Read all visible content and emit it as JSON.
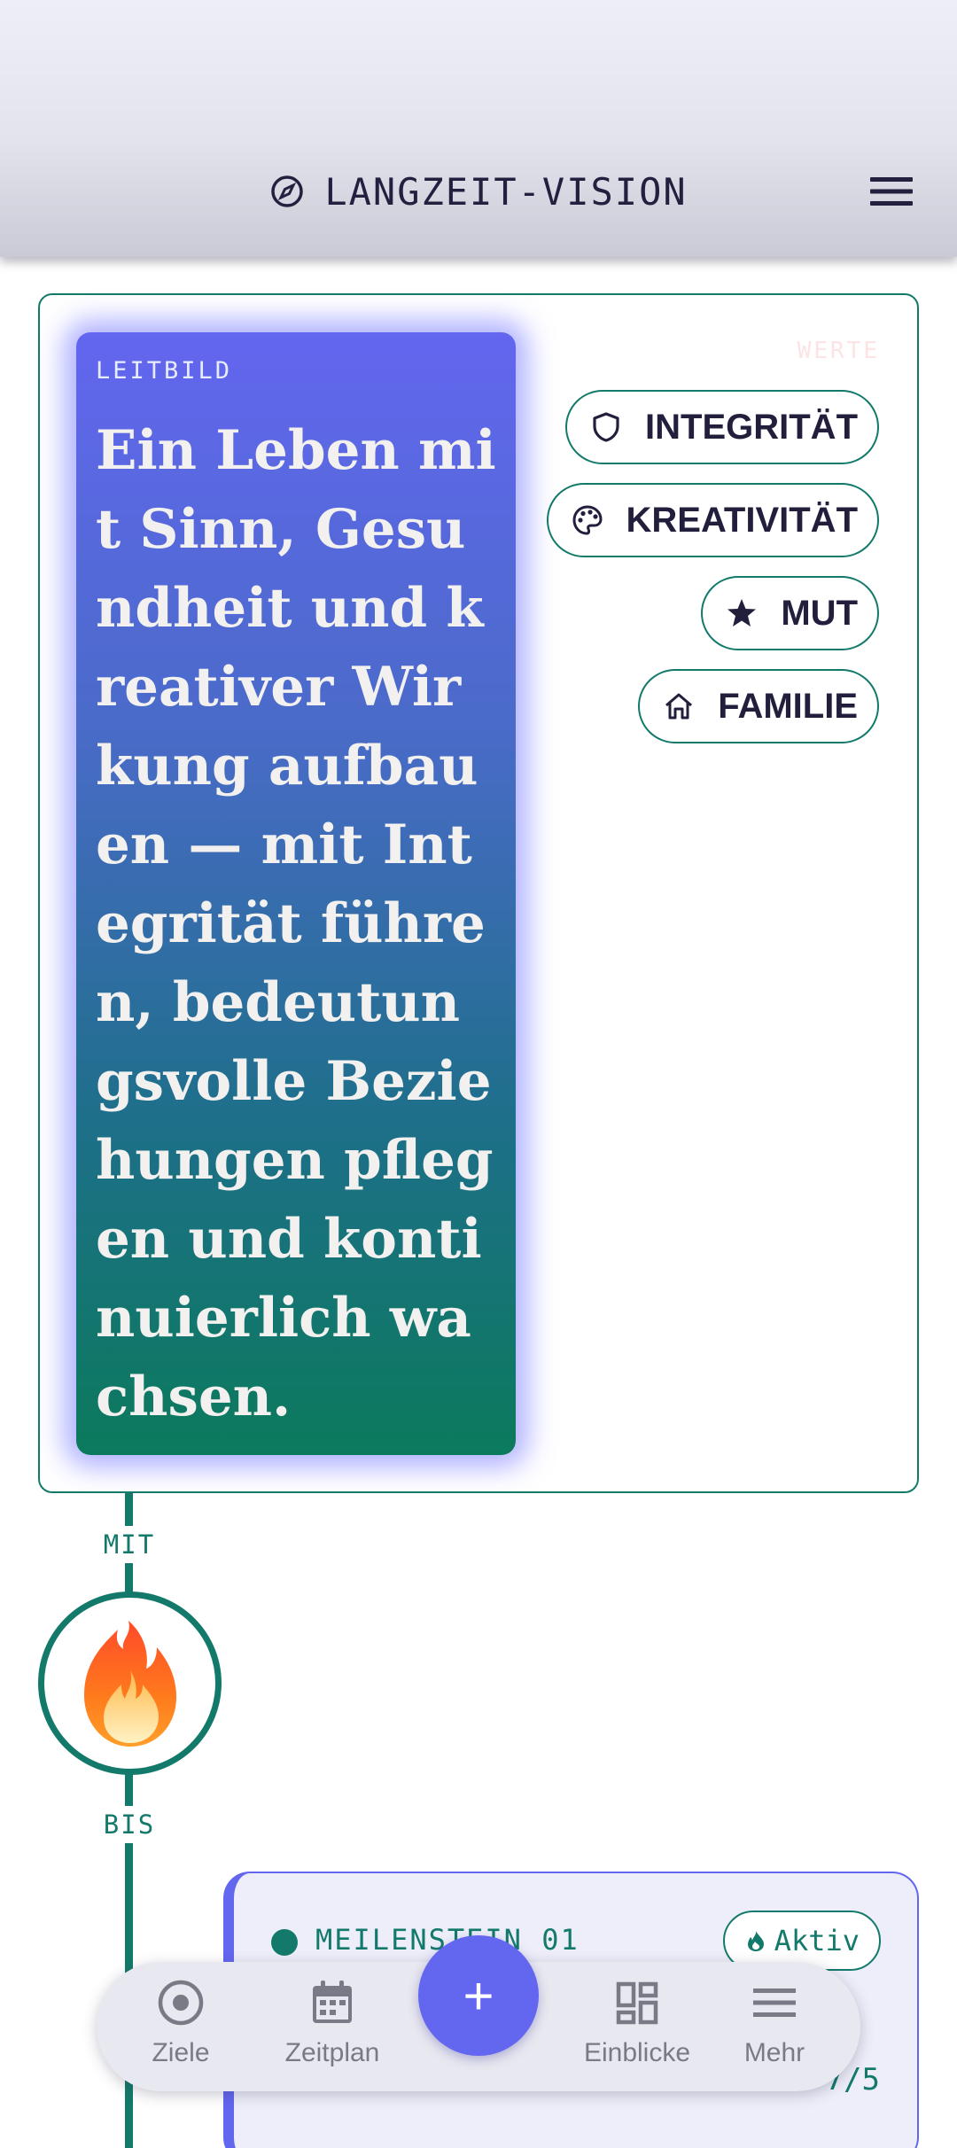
{
  "header": {
    "title": "LANGZEIT-VISION",
    "icon": "compass-icon",
    "menu_icon": "menu-icon"
  },
  "vision": {
    "leitbild_label": "LEITBILD",
    "leitbild_text": "Ein Leben mit Sinn, Gesundheit und kreativer Wirkung aufbauen — mit Integrität führen, bedeutungsvolle Beziehungen pflegen und kontinuierlich wachsen.",
    "werte_label": "WERTE",
    "values": [
      {
        "label": "INTEGRITÄT",
        "icon": "shield-icon"
      },
      {
        "label": "KREATIVITÄT",
        "icon": "palette-icon"
      },
      {
        "label": "MUT",
        "icon": "star-icon"
      },
      {
        "label": "FAMILIE",
        "icon": "home-icon"
      }
    ]
  },
  "timeline": {
    "mit_label": "MIT",
    "bis_label": "BIS",
    "emoji": "🔥"
  },
  "milestone": {
    "label": "MEILENSTEIN 01",
    "status": "Aktiv",
    "progress": "7/5"
  },
  "nav": {
    "items": [
      {
        "label": "Ziele",
        "icon": "target-icon"
      },
      {
        "label": "Zeitplan",
        "icon": "calendar-icon"
      },
      {
        "label": "Einblicke",
        "icon": "dashboard-icon"
      },
      {
        "label": "Mehr",
        "icon": "menu-icon"
      }
    ],
    "fab_label": "+"
  },
  "colors": {
    "accent": "#6366ef",
    "teal": "#137a6b",
    "text_dark": "#221f3d"
  }
}
